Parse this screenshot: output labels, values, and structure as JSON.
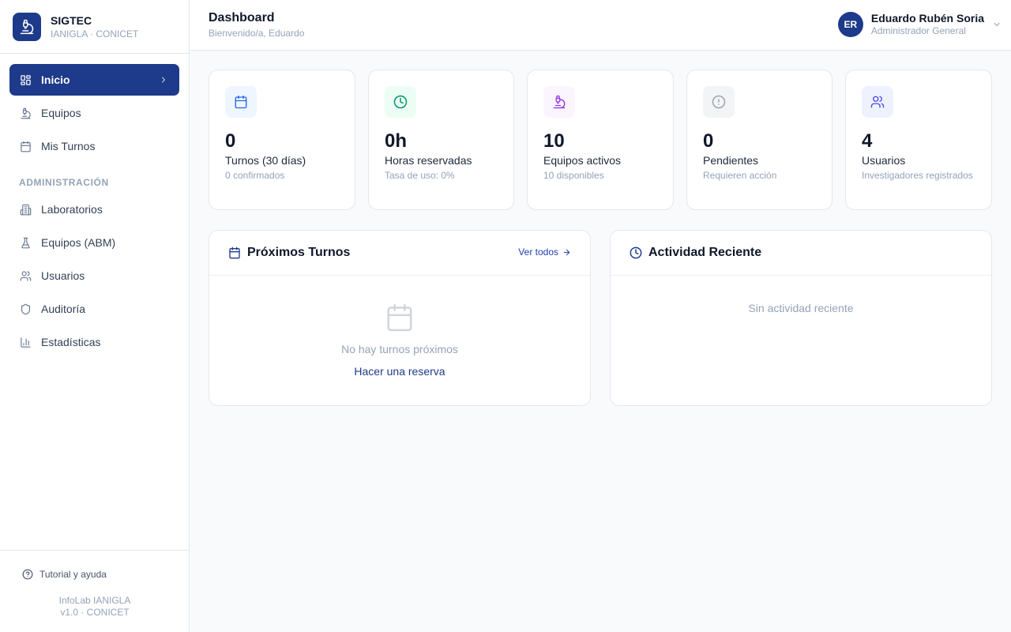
{
  "brand": {
    "name": "SIGTEC",
    "subtitle": "IANIGLA · CONICET",
    "icon": "microscope-icon"
  },
  "sidebar": {
    "items": [
      {
        "label": "Inicio",
        "icon": "dashboard-grid-icon",
        "active": true
      },
      {
        "label": "Equipos",
        "icon": "microscope-icon"
      },
      {
        "label": "Mis Turnos",
        "icon": "calendar-icon"
      }
    ],
    "admin_section_label": "ADMINISTRACIÓN",
    "admin_items": [
      {
        "label": "Laboratorios",
        "icon": "building-icon"
      },
      {
        "label": "Equipos (ABM)",
        "icon": "flask-icon"
      },
      {
        "label": "Usuarios",
        "icon": "users-icon"
      },
      {
        "label": "Auditoría",
        "icon": "shield-icon"
      },
      {
        "label": "Estadísticas",
        "icon": "bar-chart-icon"
      }
    ],
    "help_label": "Tutorial y ayuda",
    "footer_line1": "InfoLab IANIGLA",
    "footer_line2": "v1.0 · CONICET"
  },
  "header": {
    "title": "Dashboard",
    "subtitle": "Bienvenido/a, Eduardo",
    "user": {
      "initials": "ER",
      "name": "Eduardo Rubén Soria",
      "role": "Administrador General"
    }
  },
  "stats": [
    {
      "value": "0",
      "label": "Turnos (30 días)",
      "sub": "0 confirmados",
      "icon": "calendar-icon",
      "color": "#2563eb",
      "bg": "#eff6ff"
    },
    {
      "value": "0h",
      "label": "Horas reservadas",
      "sub": "Tasa de uso: 0%",
      "icon": "clock-icon",
      "color": "#059669",
      "bg": "#ecfdf5"
    },
    {
      "value": "10",
      "label": "Equipos activos",
      "sub": "10 disponibles",
      "icon": "microscope-icon",
      "color": "#9333ea",
      "bg": "#faf5ff"
    },
    {
      "value": "0",
      "label": "Pendientes",
      "sub": "Requieren acción",
      "icon": "alert-circle-icon",
      "color": "#9ca3af",
      "bg": "#f3f4f6"
    },
    {
      "value": "4",
      "label": "Usuarios",
      "sub": "Investigadores registrados",
      "icon": "users-icon",
      "color": "#4f46e5",
      "bg": "#eef2ff"
    }
  ],
  "upcoming": {
    "title": "Próximos Turnos",
    "view_all": "Ver todos",
    "empty_text": "No hay turnos próximos",
    "cta": "Hacer una reserva"
  },
  "activity": {
    "title": "Actividad Reciente",
    "empty_text": "Sin actividad reciente"
  },
  "colors": {
    "primary": "#1e3a8a",
    "muted": "#94a3b8",
    "border": "#e5e7eb"
  }
}
